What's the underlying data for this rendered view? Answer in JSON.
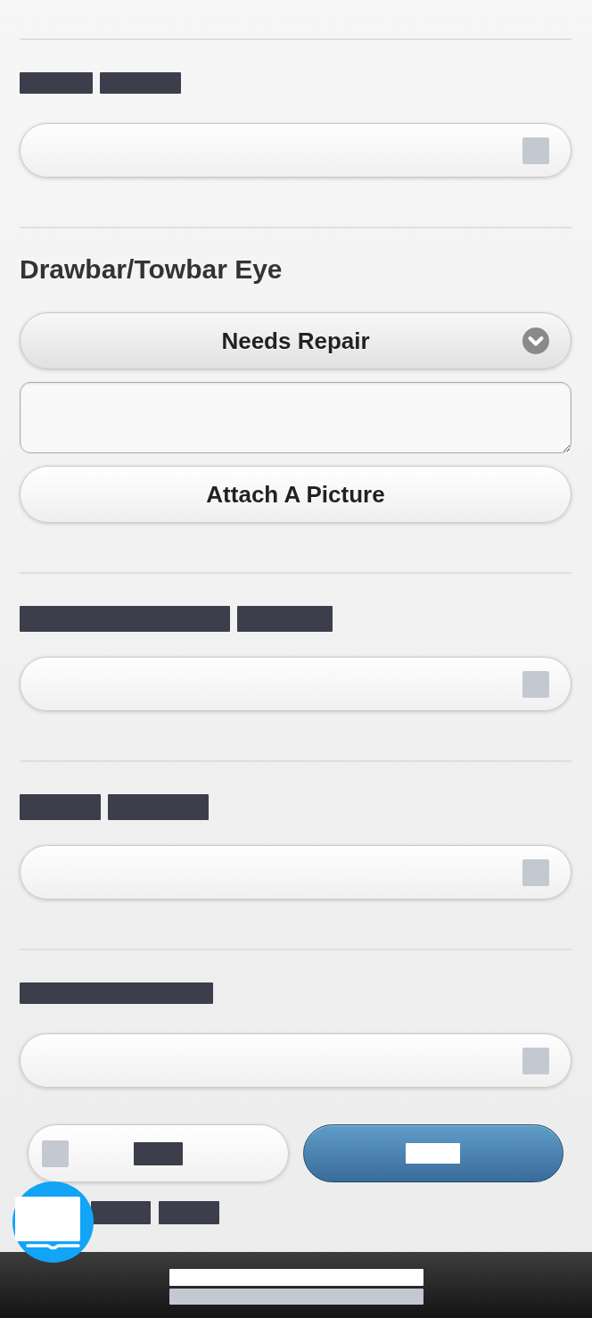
{
  "sections": [
    {
      "kind": "select",
      "label_blocks": [
        {
          "kind": "redacted"
        },
        {
          "kind": "redacted"
        }
      ]
    },
    {
      "kind": "inspection",
      "title": "Drawbar/Towbar Eye",
      "status": "Needs Repair",
      "notes": {
        "kind": "textarea"
      },
      "attach_button": "Attach A Picture"
    },
    {
      "kind": "select",
      "label_blocks": [
        {
          "kind": "redacted"
        },
        {
          "kind": "redacted"
        }
      ]
    },
    {
      "kind": "select",
      "label_blocks": [
        {
          "kind": "redacted"
        },
        {
          "kind": "redacted"
        }
      ]
    },
    {
      "kind": "select",
      "label_blocks": [
        {
          "kind": "redacted"
        }
      ]
    }
  ],
  "actions": [
    {
      "kind": "secondary",
      "label_blocks": [
        {
          "kind": "redacted"
        }
      ]
    },
    {
      "kind": "primary",
      "label_blocks": [
        {
          "kind": "redacted"
        }
      ]
    }
  ],
  "footer_links": [
    {
      "kind": "redacted"
    },
    {
      "kind": "redacted"
    }
  ],
  "footer": {
    "lines": [
      {
        "kind": "redacted"
      },
      {
        "kind": "redacted"
      }
    ]
  }
}
